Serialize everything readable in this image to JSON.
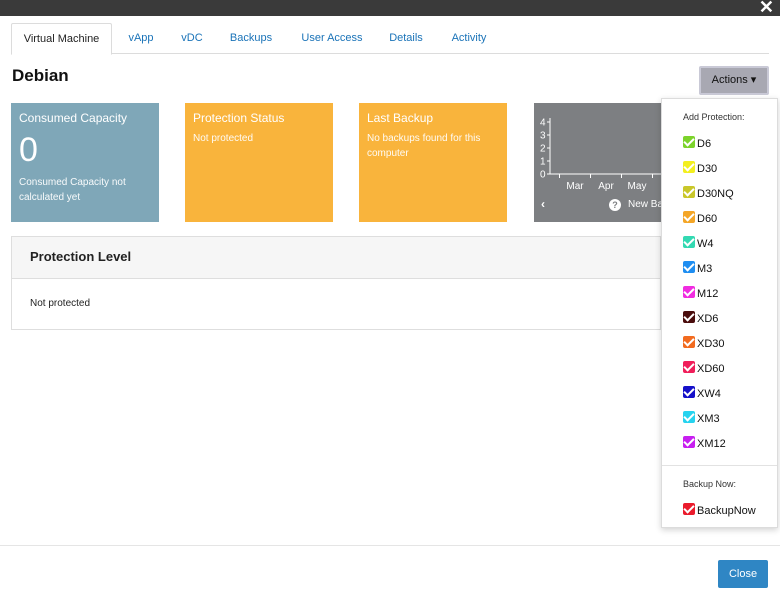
{
  "window": {
    "close_symbol": "✕"
  },
  "tabs": [
    {
      "label": "Virtual Machine"
    },
    {
      "label": "vApp"
    },
    {
      "label": "vDC"
    },
    {
      "label": "Backups"
    },
    {
      "label": "User Access"
    },
    {
      "label": "Details"
    },
    {
      "label": "Activity"
    }
  ],
  "vm_name": "Debian",
  "actions": {
    "label": "Actions ▾"
  },
  "cards": {
    "capacity": {
      "title": "Consumed Capacity",
      "value": "0",
      "note": "Consumed Capacity not calculated yet"
    },
    "protection": {
      "title": "Protection Status",
      "status": "Not protected"
    },
    "last_backup": {
      "title": "Last Backup",
      "note": "No backups found for this computer"
    },
    "chart_panel": {
      "nav_prev": "‹",
      "new_backup_label": "New Ba",
      "help_icon": "help-icon"
    }
  },
  "chart_data": {
    "type": "bar",
    "categories": [
      "Mar",
      "Apr",
      "May"
    ],
    "values": [
      0,
      0,
      0
    ],
    "ylim": [
      0,
      4
    ],
    "yticks": [
      "0",
      "1",
      "2",
      "3",
      "4"
    ],
    "title": "",
    "xlabel": "",
    "ylabel": ""
  },
  "protection_level": {
    "title": "Protection Level",
    "value": "Not protected"
  },
  "dropdown": {
    "add_protection_header": "Add Protection:",
    "protection_items": [
      {
        "label": "D6",
        "color": "#7cd32b"
      },
      {
        "label": "D30",
        "color": "#f3ef1f"
      },
      {
        "label": "D30NQ",
        "color": "#c9c72a"
      },
      {
        "label": "D60",
        "color": "#f4a627"
      },
      {
        "label": "W4",
        "color": "#33d9b2"
      },
      {
        "label": "M3",
        "color": "#1f8ef1"
      },
      {
        "label": "M12",
        "color": "#f02ce0"
      },
      {
        "label": "XD6",
        "color": "#4a0d0d"
      },
      {
        "label": "XD30",
        "color": "#f26b1f"
      },
      {
        "label": "XD60",
        "color": "#f01e5a"
      },
      {
        "label": "XW4",
        "color": "#1510c9"
      },
      {
        "label": "XM3",
        "color": "#26d3ef"
      },
      {
        "label": "XM12",
        "color": "#c71ff0"
      }
    ],
    "backup_now_header": "Backup Now:",
    "backup_now_item": {
      "label": "BackupNow",
      "color": "#ea1b2c"
    }
  },
  "footer": {
    "close_label": "Close"
  }
}
